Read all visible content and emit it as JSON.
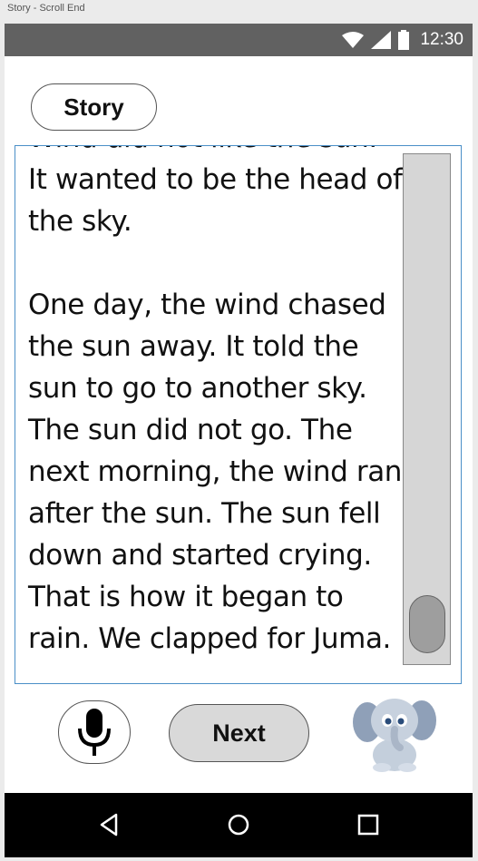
{
  "window": {
    "title": "Story - Scroll End"
  },
  "status_bar": {
    "time": "12:30",
    "icons": [
      "wifi-icon",
      "cell-signal-icon",
      "battery-icon"
    ]
  },
  "header": {
    "story_button_label": "Story"
  },
  "story": {
    "paragraphs": [
      "Wind did not like the sun. It wanted to be the head of the sky.",
      "One day, the wind chased the sun away. It told the sun to go to another sky. The sun did not go. The next morning, the wind ran after the sun. The sun fell down and started crying. That is how it began to rain. We clapped for Juma."
    ],
    "scroll_position": 1.0
  },
  "controls": {
    "mic_icon": "microphone-icon",
    "next_label": "Next",
    "mascot": "elephant-mascot"
  },
  "nav_bar": {
    "icons": [
      "back-icon",
      "home-icon",
      "recents-icon"
    ]
  },
  "colors": {
    "status_bar": "#616161",
    "panel_border": "#4a8fc7",
    "next_button_fill": "#d9d9d9",
    "scroll_track": "#d6d6d6",
    "scroll_thumb": "#9e9e9e"
  }
}
